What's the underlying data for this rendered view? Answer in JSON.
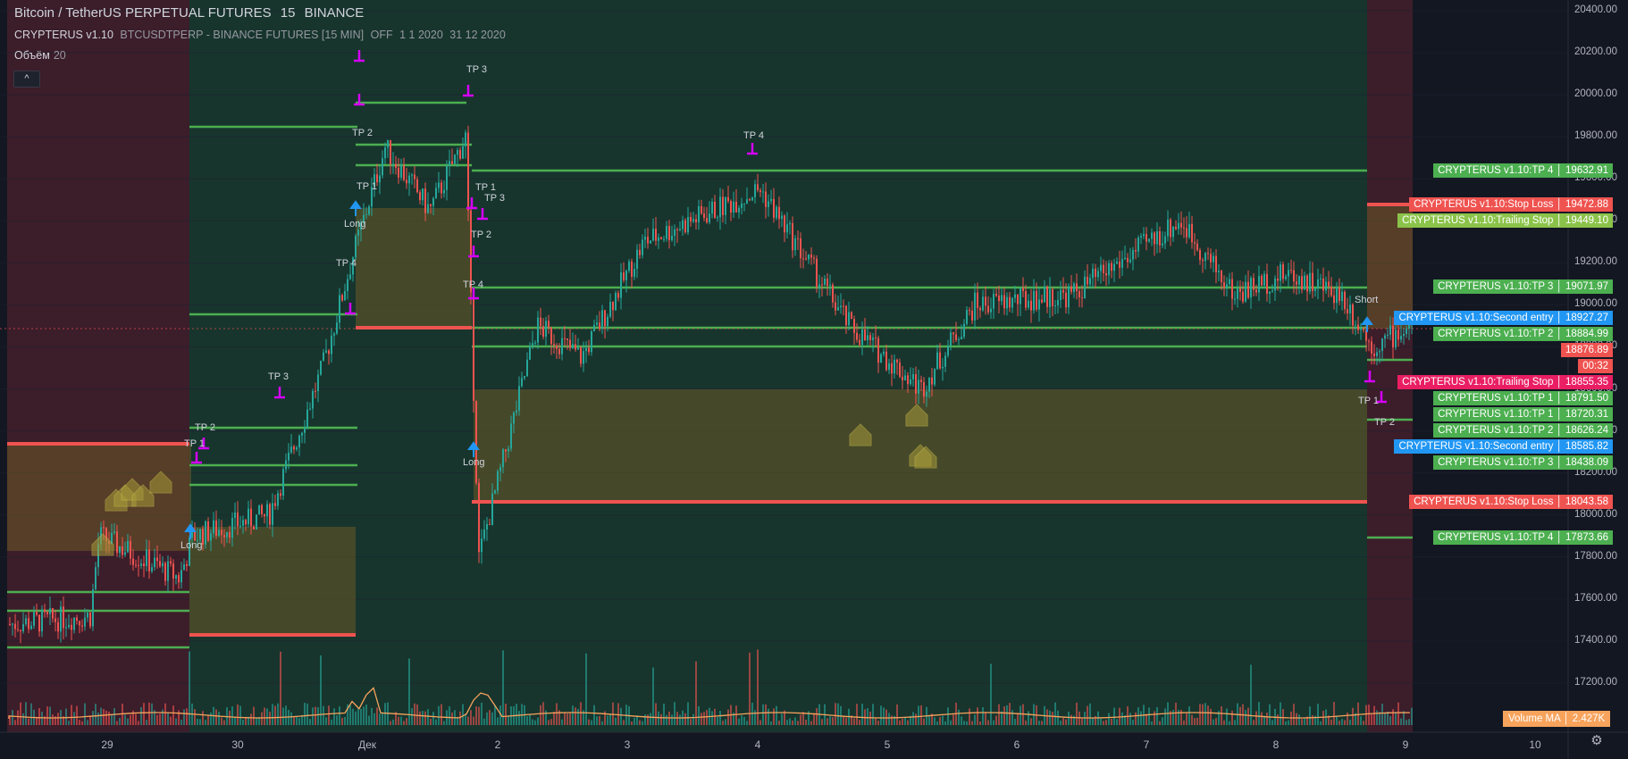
{
  "header": {
    "symbol": "Bitcoin / TetherUS PERPETUAL FUTURES",
    "interval": "15",
    "exchange": "BINANCE",
    "indicator_name": "CRYPTERUS v1.10",
    "indicator_params": [
      "BTCUSDTPERP - BINANCE FUTURES [15 MIN]",
      "OFF",
      "1 1 2020",
      "31 12 2020"
    ],
    "volume_label": "Объём",
    "volume_length": "20",
    "collapse_icon": "^"
  },
  "colors": {
    "background": "#131722",
    "zone_red": "#3c1d2a",
    "zone_green": "#17352d",
    "box_orange": "#6b5a26",
    "tp_line": "#4caf50",
    "stop_line": "#ef5350",
    "marker": "#d500f9",
    "entry_arrow": "#2196f3",
    "candle_up": "#26a69a",
    "candle_down": "#ef5350",
    "volume_ma": "#f7a35c"
  },
  "price_axis": {
    "min": 17000,
    "max": 20400,
    "labels": [
      "20400.00",
      "20200.00",
      "20000.00",
      "19800.00",
      "19600.00",
      "19400.00",
      "19200.00",
      "19000.00",
      "18800.00",
      "18600.00",
      "18400.00",
      "18200.00",
      "18000.00",
      "17800.00",
      "17600.00",
      "17400.00",
      "17200.00"
    ]
  },
  "time_axis": {
    "labels": [
      "29",
      "30",
      "Дек",
      "2",
      "3",
      "4",
      "5",
      "6",
      "7",
      "8",
      "9",
      "10"
    ]
  },
  "price_tags": [
    {
      "text": "CRYPTERUS v1.10:TP 4 │ 19632.91",
      "price": 19632.91,
      "color": "#4caf50"
    },
    {
      "text": "CRYPTERUS v1.10:Stop Loss │ 19472.88",
      "price": 19472.88,
      "color": "#ef5350"
    },
    {
      "text": "CRYPTERUS v1.10:Trailing Stop │ 19449.10",
      "price": 19449.1,
      "color": "#8bc34a"
    },
    {
      "text": "CRYPTERUS v1.10:TP 3 │ 19071.97",
      "price": 19071.97,
      "color": "#4caf50"
    },
    {
      "text": "CRYPTERUS v1.10:Second entry │ 18927.27",
      "price": 18927.27,
      "color": "#2196f3"
    },
    {
      "text": "CRYPTERUS v1.10:TP 2 │ 18884.99",
      "price": 18884.99,
      "color": "#4caf50"
    },
    {
      "text": "18876.89",
      "price": 18876.89,
      "color": "#ef5350"
    },
    {
      "text": "00:32",
      "price": 18810,
      "color": "#ef5350"
    },
    {
      "text": "CRYPTERUS v1.10:Trailing Stop │ 18855.35",
      "price": 18855.35,
      "color": "#e91e63"
    },
    {
      "text": "CRYPTERUS v1.10:TP 1 │ 18791.50",
      "price": 18791.5,
      "color": "#4caf50"
    },
    {
      "text": "CRYPTERUS v1.10:TP 1 │ 18720.31",
      "price": 18720.31,
      "color": "#4caf50"
    },
    {
      "text": "CRYPTERUS v1.10:TP 2 │ 18626.24",
      "price": 18626.24,
      "color": "#4caf50"
    },
    {
      "text": "CRYPTERUS v1.10:Second entry │ 18585.82",
      "price": 18585.82,
      "color": "#2196f3"
    },
    {
      "text": "CRYPTERUS v1.10:TP 3 │ 18438.09",
      "price": 18438.09,
      "color": "#4caf50"
    },
    {
      "text": "CRYPTERUS v1.10:Stop Loss │ 18043.58",
      "price": 18043.58,
      "color": "#ef5350"
    },
    {
      "text": "CRYPTERUS v1.10:TP 4 │ 17873.66",
      "price": 17873.66,
      "color": "#4caf50"
    }
  ],
  "chart_labels": [
    {
      "text": "TP 1",
      "key": "tp1-a"
    },
    {
      "text": "TP 2",
      "key": "tp2-a"
    },
    {
      "text": "Long",
      "key": "long-a"
    },
    {
      "text": "TP 3",
      "key": "tp3-a"
    },
    {
      "text": "TP 4",
      "key": "tp4-a"
    },
    {
      "text": "Long",
      "key": "long-b"
    },
    {
      "text": "TP 1",
      "key": "tp1-b"
    },
    {
      "text": "TP 2",
      "key": "tp2-b"
    },
    {
      "text": "TP 3",
      "key": "tp3-b"
    },
    {
      "text": "TP 4",
      "key": "tp4-b"
    },
    {
      "text": "TP 1",
      "key": "tp1-c"
    },
    {
      "text": "TP 2",
      "key": "tp2-c"
    },
    {
      "text": "TP 3",
      "key": "tp3-c"
    },
    {
      "text": "Long",
      "key": "long-c"
    },
    {
      "text": "TP 4",
      "key": "tp4-c"
    },
    {
      "text": "Short",
      "key": "short-a"
    },
    {
      "text": "TP 1",
      "key": "tp1-d"
    },
    {
      "text": "TP 2",
      "key": "tp2-d"
    }
  ],
  "volume_ma": {
    "label": "Volume MA",
    "value": "2.427K"
  },
  "icons": {
    "settings": "gear-icon",
    "collapse": "chevron-up-icon"
  }
}
